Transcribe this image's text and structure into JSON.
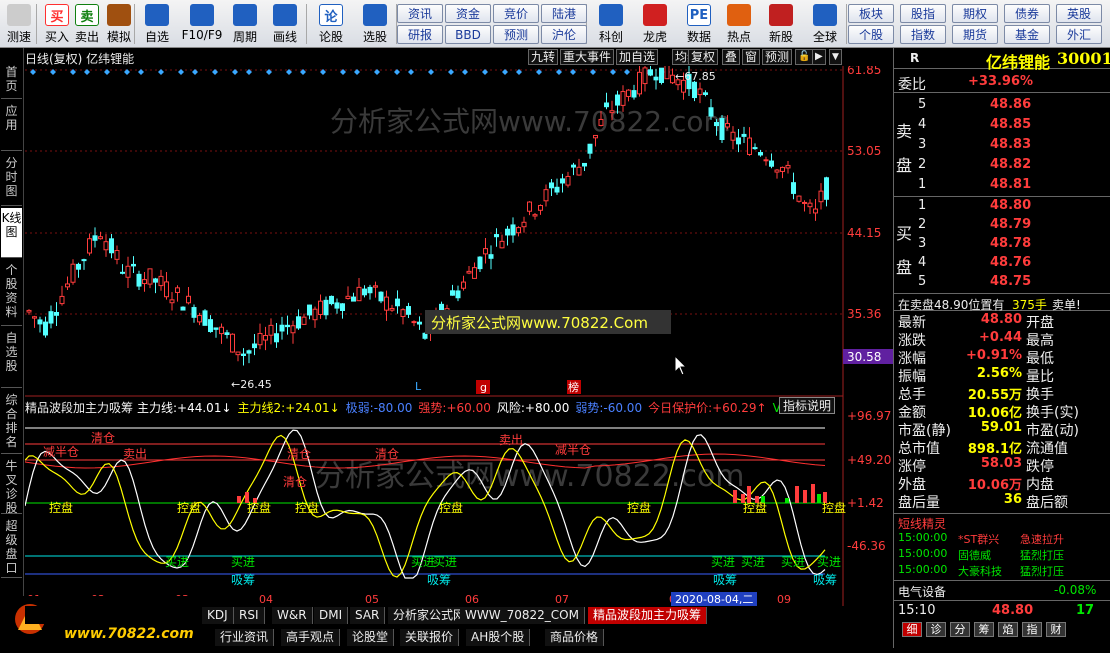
{
  "toolbar": {
    "buttons": [
      {
        "label": "测速",
        "icon": "speed-icon",
        "color": "#cccccc"
      },
      {
        "label": "买入",
        "icon": "buy-icon",
        "color": "#ff3030",
        "glyph": "买"
      },
      {
        "label": "卖出",
        "icon": "sell-icon",
        "color": "#108010",
        "glyph": "卖"
      },
      {
        "label": "模拟",
        "icon": "hammer-icon",
        "color": "#a05010"
      },
      {
        "label": "自选",
        "icon": "star-icon",
        "color": "#2060c0"
      },
      {
        "label": "F10/F9",
        "icon": "f10-icon",
        "color": "#2060c0"
      },
      {
        "label": "周期",
        "icon": "clock-icon",
        "color": "#2060c0"
      },
      {
        "label": "画线",
        "icon": "pen-icon",
        "color": "#2060c0"
      },
      {
        "label": "论股",
        "icon": "chat-icon",
        "color": "#2060c0",
        "glyph": "论"
      },
      {
        "label": "选股",
        "icon": "select-icon",
        "color": "#2060c0"
      },
      {
        "label": "科创",
        "icon": "chart-icon",
        "color": "#2060c0"
      },
      {
        "label": "龙虎",
        "icon": "dragon-icon",
        "color": "#d02020"
      },
      {
        "label": "数据",
        "icon": "pe-icon",
        "color": "#2060c0",
        "glyph": "PE"
      },
      {
        "label": "热点",
        "icon": "hot-icon",
        "color": "#e06010"
      },
      {
        "label": "新股",
        "icon": "newstock-icon",
        "color": "#c02020"
      },
      {
        "label": "全球",
        "icon": "globe-icon",
        "color": "#2060c0"
      }
    ],
    "grid_left": [
      "资讯",
      "资金",
      "竞价",
      "陆港",
      "研报",
      "BBD",
      "预测",
      "沪伦"
    ],
    "grid_right": [
      "板块",
      "股指",
      "期权",
      "债券",
      "英股",
      "个股",
      "指数",
      "期货",
      "基金",
      "外汇"
    ]
  },
  "leftnav": [
    "首页",
    "应用",
    "分时图",
    "K线图",
    "个股资料",
    "自选股",
    "综合排名",
    "牛叉诊股",
    "超级盘口"
  ],
  "kchart": {
    "title": "日线(复权) 亿纬锂能",
    "buttons": [
      "九转",
      "重大事件",
      "加自选",
      "均线",
      "复权",
      "叠",
      "窗",
      "预测"
    ],
    "price_axis": [
      "61.85",
      "53.05",
      "44.15",
      "35.36",
      "30.58"
    ],
    "high_label": "67.85",
    "low_label": "26.45",
    "watermark": "分析家公式网www.70822.com",
    "banner": "分析家公式网www.70822.Com",
    "markers": [
      "L",
      "g",
      "榜"
    ]
  },
  "indicator": {
    "name": "精品波段加主力吸筹",
    "values": [
      {
        "label": "主力线:",
        "value": "+44.01↓",
        "color": "#ffffff"
      },
      {
        "label": "主力线2:",
        "value": "+24.01↓",
        "color": "#ffff00"
      },
      {
        "label": "极弱:",
        "value": "-80.00",
        "color": "#4a80ff"
      },
      {
        "label": "强势:",
        "value": "+60.00",
        "color": "#ff3c3c"
      },
      {
        "label": "风险:",
        "value": "+80.00",
        "color": "#ffffff"
      },
      {
        "label": "弱势:",
        "value": "-60.00",
        "color": "#4a80ff"
      },
      {
        "label": "今日保护价:",
        "value": "+60.29↑",
        "color": "#ff3c3c"
      },
      {
        "label": "VAR6:",
        "value": "+0",
        "color": "#00e600"
      }
    ],
    "help_button": "指标说明",
    "axis": [
      "+96.97",
      "+49.20",
      "+1.42",
      "-46.36"
    ],
    "labels_yellow": [
      "控盘",
      "控盘",
      "控盘",
      "控盘",
      "控盘",
      "控盘",
      "控盘",
      "控盘",
      "控盘"
    ],
    "labels_buy": [
      "买进",
      "买进",
      "买进",
      "买进",
      "买进",
      "买进",
      "买进",
      "买进"
    ],
    "labels_absorb": [
      "吸筹",
      "吸筹",
      "吸筹",
      "吸筹",
      "吸筹"
    ],
    "labels_red": [
      "清仓",
      "减半仓",
      "卖出",
      "清仓",
      "清仓",
      "清仓",
      "卖出",
      "减半仓"
    ],
    "x_axis": [
      "01",
      "02",
      "03",
      "04",
      "05",
      "06",
      "07",
      "08",
      "09"
    ],
    "date_badge": "2020-08-04,二"
  },
  "bottom_tabs": [
    "KDJ",
    "RSI",
    "W&R",
    "DMI",
    "SAR",
    "分析家公式网",
    "WWW_70822_COM",
    "精品波段加主力吸筹"
  ],
  "bottom_tabs2": [
    "行业资讯",
    "高手观点",
    "论股堂",
    "关联报价",
    "AH股个股",
    "商品价格"
  ],
  "logo": {
    "text": "分析家公式网",
    "url": "www.70822.com"
  },
  "quote": {
    "r_label": "R",
    "name": "亿纬锂能",
    "code": "300014",
    "weibi_label": "委比",
    "weibi": "+33.96%",
    "sell_label": [
      "卖",
      "盘"
    ],
    "buy_label": [
      "买",
      "盘"
    ],
    "sells": [
      {
        "lvl": "5",
        "price": "48.86"
      },
      {
        "lvl": "4",
        "price": "48.85"
      },
      {
        "lvl": "3",
        "price": "48.83"
      },
      {
        "lvl": "2",
        "price": "48.82"
      },
      {
        "lvl": "1",
        "price": "48.81"
      }
    ],
    "buys": [
      {
        "lvl": "1",
        "price": "48.80"
      },
      {
        "lvl": "2",
        "price": "48.79"
      },
      {
        "lvl": "3",
        "price": "48.78"
      },
      {
        "lvl": "4",
        "price": "48.76"
      },
      {
        "lvl": "5",
        "price": "48.75"
      }
    ],
    "notice_a": "在卖盘48.90位置有",
    "notice_b": "375手",
    "notice_c": "卖单!",
    "stats": [
      {
        "l1": "最新",
        "v1": "48.80",
        "c1": "#ff3c3c",
        "l2": "开盘"
      },
      {
        "l1": "涨跌",
        "v1": "+0.44",
        "c1": "#ff3c3c",
        "l2": "最高"
      },
      {
        "l1": "涨幅",
        "v1": "+0.91%",
        "c1": "#ff3c3c",
        "l2": "最低"
      },
      {
        "l1": "振幅",
        "v1": "2.56%",
        "c1": "#ffff00",
        "l2": "量比"
      },
      {
        "l1": "总手",
        "v1": "20.55万",
        "c1": "#ffff00",
        "l2": "换手"
      },
      {
        "l1": "金额",
        "v1": "10.06亿",
        "c1": "#ffff00",
        "l2": "换手(实)"
      },
      {
        "l1": "市盈(静)",
        "v1": "59.01",
        "c1": "#ffff00",
        "l2": "市盈(动)"
      },
      {
        "l1": "总市值",
        "v1": "898.1亿",
        "c1": "#ffff00",
        "l2": "流通值"
      },
      {
        "l1": "涨停",
        "v1": "58.03",
        "c1": "#ff3c3c",
        "l2": "跌停"
      },
      {
        "l1": "外盘",
        "v1": "10.06万",
        "c1": "#ff3c3c",
        "l2": "内盘"
      },
      {
        "l1": "盘后量",
        "v1": "36",
        "c1": "#ffff00",
        "l2": "盘后额"
      }
    ],
    "elf_title": "短线精灵",
    "elf": [
      {
        "time": "15:00:00",
        "name": "*ST群兴",
        "event": "急速拉升",
        "color": "#ff3c3c"
      },
      {
        "time": "15:00:00",
        "name": "固德威",
        "event": "猛烈打压",
        "color": "#00e600"
      },
      {
        "time": "15:00:00",
        "name": "大豪科技",
        "event": "猛烈打压",
        "color": "#00e600"
      }
    ],
    "sector_name": "电气设备",
    "sector_change": "-0.08%",
    "last_time": "15:10",
    "last_price": "48.80",
    "last_vol": "17",
    "bottom_tabs": [
      "细",
      "诊",
      "分",
      "筹",
      "焰",
      "指",
      "财"
    ]
  }
}
